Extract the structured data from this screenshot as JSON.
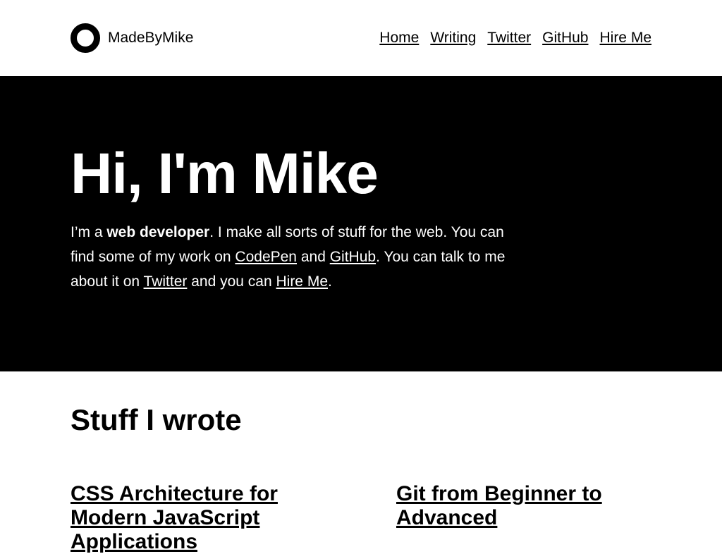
{
  "header": {
    "brand": "MadeByMike",
    "nav": [
      "Home",
      "Writing",
      "Twitter",
      "GitHub",
      "Hire Me"
    ]
  },
  "hero": {
    "title": "Hi, I'm Mike",
    "intro_prefix": "I’m a ",
    "intro_strong": "web developer",
    "intro_mid1": ". I make all sorts of stuff for the web. You can find some of my work on ",
    "link_codepen": "CodePen",
    "and1": " and ",
    "link_github": "GitHub",
    "mid2": ". You can talk to me about it on ",
    "link_twitter": "Twitter",
    "and2": " and you can ",
    "link_hire": "Hire Me",
    "end": "."
  },
  "articles": {
    "section_title": "Stuff I wrote",
    "items": [
      "CSS Architecture for Modern JavaScript Applications",
      "Git from Beginner to Advanced"
    ]
  },
  "colors": {
    "background": "#ffffff",
    "hero_background": "#000000",
    "text": "#000000",
    "hero_text": "#ffffff"
  }
}
